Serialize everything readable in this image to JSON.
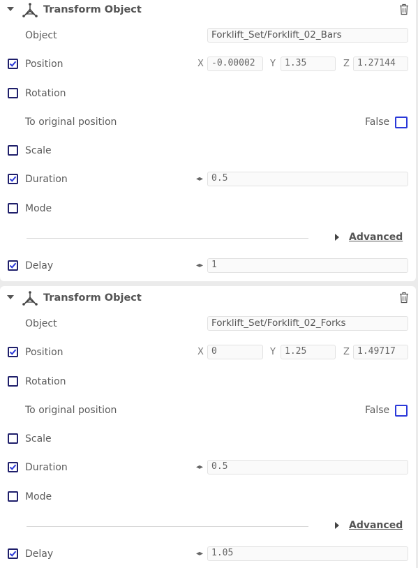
{
  "components": [
    {
      "title": "Transform Object",
      "object_label": "Object",
      "object_value": "Forklift_Set/Forklift_02_Bars",
      "position": {
        "label": "Position",
        "checked": true,
        "x_label": "X",
        "x": "-0.00002",
        "y_label": "Y",
        "y": "1.35",
        "z_label": "Z",
        "z": "1.27144"
      },
      "rotation": {
        "label": "Rotation",
        "checked": false
      },
      "to_original": {
        "label": "To original position",
        "value": "False"
      },
      "scale": {
        "label": "Scale",
        "checked": false
      },
      "duration": {
        "label": "Duration",
        "checked": true,
        "value": "0.5"
      },
      "mode": {
        "label": "Mode",
        "checked": false
      },
      "advanced_label": "Advanced",
      "delay": {
        "label": "Delay",
        "checked": true,
        "value": "1"
      }
    },
    {
      "title": "Transform Object",
      "object_label": "Object",
      "object_value": "Forklift_Set/Forklift_02_Forks",
      "position": {
        "label": "Position",
        "checked": true,
        "x_label": "X",
        "x": "0",
        "y_label": "Y",
        "y": "1.25",
        "z_label": "Z",
        "z": "1.49717"
      },
      "rotation": {
        "label": "Rotation",
        "checked": false
      },
      "to_original": {
        "label": "To original position",
        "value": "False"
      },
      "scale": {
        "label": "Scale",
        "checked": false
      },
      "duration": {
        "label": "Duration",
        "checked": true,
        "value": "0.5"
      },
      "mode": {
        "label": "Mode",
        "checked": false
      },
      "advanced_label": "Advanced",
      "delay": {
        "label": "Delay",
        "checked": true,
        "value": "1.05"
      }
    }
  ],
  "icons": {
    "collapse": "caret-down-icon",
    "component": "transform-axes-icon",
    "delete": "trash-icon",
    "advanced": "caret-right-icon",
    "drag": "drag-handle-icon"
  },
  "colors": {
    "checkbox_border": "#1f1f6b",
    "checkmark": "#2b39d9",
    "bool_box": "#2b39d9"
  }
}
